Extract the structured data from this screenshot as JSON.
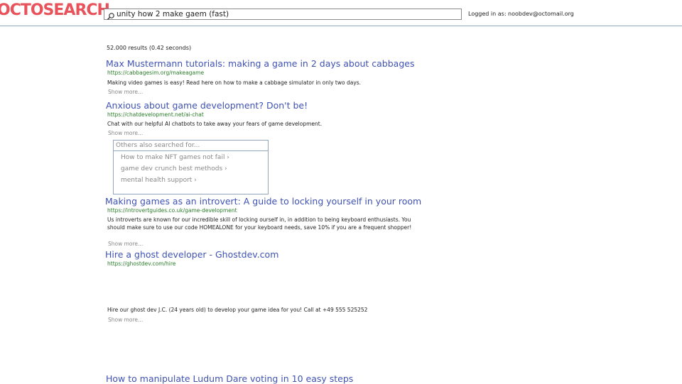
{
  "header": {
    "logo": "OCTOSEARCH",
    "search_query": "unity how 2 make gaem (fast)",
    "search_icon": "search-icon",
    "login_status": "Logged in as: noobdev@octomail.org"
  },
  "results_info": "52.000 results (0.42 seconds)",
  "results": [
    {
      "title": "Max Mustermann tutorials: making a game in 2 days about cabbages",
      "url": "https://cabbagesim.org/makeagame",
      "snippet": "Making video games is easy! Read here on how to make a cabbage simulator in only two days.",
      "show_more": "Show more..."
    },
    {
      "title": "Anxious about game development? Don't be!",
      "url": "https://chatdevelopment.net/ai-chat",
      "snippet": "Chat with our helpful AI chatbots to take away your fears of game development.",
      "show_more": "Show more..."
    },
    {
      "title": "Making games as an introvert: A guide to locking yourself in your room",
      "url": "https://introvertguides.co.uk/game-development",
      "snippet": "Us introverts are known for our incredible skill of locking ourself in, in addition to being keyboard enthusiasts. You should make sure to use our code HOMEALONE for your keyboard needs, save 10% if you are a frequent shopper!",
      "show_more": "Show more..."
    },
    {
      "title": "Hire a ghost developer - Ghostdev.com",
      "url": "https://ghostdev.com/hire",
      "snippet": "Hire our ghost dev J.C. (24 years old) to develop your game idea for you! Call at +49 555 525252",
      "show_more": "Show more..."
    },
    {
      "title": "How to manipulate Ludum Dare voting in 10 easy steps"
    }
  ],
  "related": {
    "header": "Others also searched for...",
    "items": [
      "How to make NFT games not fail ›",
      "game dev crunch best methods ›",
      "mental health support ›"
    ]
  }
}
